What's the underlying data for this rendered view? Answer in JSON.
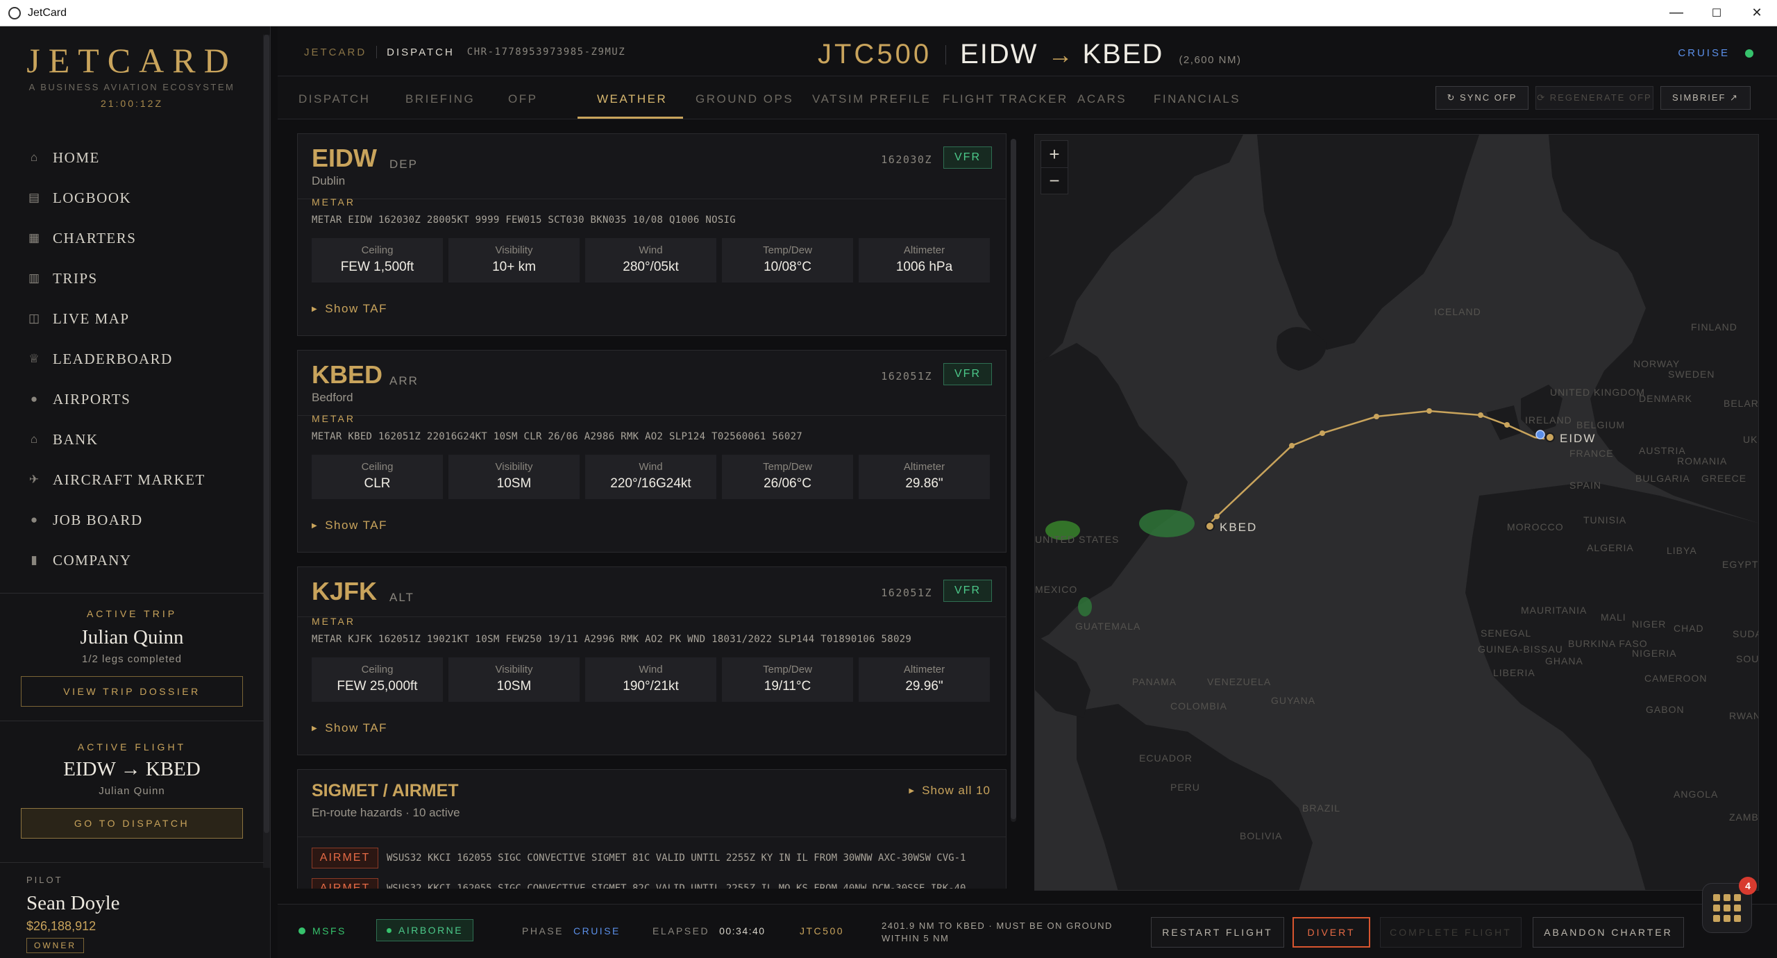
{
  "window": {
    "title": "JetCard",
    "controls": [
      "—",
      "☐",
      "✕"
    ]
  },
  "brand": {
    "name": "JETCARD",
    "tagline": "A BUSINESS AVIATION ECOSYSTEM",
    "clock": "21:00:12Z"
  },
  "nav": [
    {
      "label": "Home",
      "icon": "home-icon"
    },
    {
      "label": "Logbook",
      "icon": "book-icon"
    },
    {
      "label": "Charters",
      "icon": "calendar-icon"
    },
    {
      "label": "Trips",
      "icon": "luggage-icon"
    },
    {
      "label": "Live Map",
      "icon": "map-icon"
    },
    {
      "label": "Leaderboard",
      "icon": "trophy-icon"
    },
    {
      "label": "Airports",
      "icon": "pin-icon"
    },
    {
      "label": "Bank",
      "icon": "bank-icon"
    },
    {
      "label": "Aircraft Market",
      "icon": "plane-icon"
    },
    {
      "label": "Job Board",
      "icon": "person-icon"
    },
    {
      "label": "Company",
      "icon": "building-icon"
    }
  ],
  "active_trip": {
    "eyebrow": "ACTIVE TRIP",
    "name": "Julian Quinn",
    "progress": "1/2 legs completed",
    "button": "VIEW TRIP DOSSIER"
  },
  "active_flight": {
    "eyebrow": "ACTIVE FLIGHT",
    "route": "EIDW → KBED",
    "pax": "Julian Quinn",
    "button": "GO TO DISPATCH"
  },
  "pilot": {
    "eyebrow": "PILOT",
    "name": "Sean Doyle",
    "balance": "$26,188,912",
    "role": "OWNER"
  },
  "header": {
    "crumb_app": "JETCARD",
    "crumb_section": "DISPATCH",
    "charter_id": "CHR-1778953973985-Z9MUZ",
    "callsign": "JTC500",
    "origin": "EIDW",
    "arrow": "→",
    "destination": "KBED",
    "distance": "(2,600 NM)",
    "phase": "CRUISE"
  },
  "tabs": [
    "DISPATCH",
    "BRIEFING",
    "OFP",
    "WEATHER",
    "GROUND OPS",
    "VATSIM PREFILE",
    "FLIGHT TRACKER",
    "ACARS",
    "FINANCIALS"
  ],
  "active_tab": "WEATHER",
  "tools": {
    "sync": "↻ SYNC OFP",
    "regen": "⟳ REGENERATE OFP",
    "simbrief": "SIMBRIEF ↗"
  },
  "metar_label": "METAR",
  "taf_label": "Show TAF",
  "tile_labels": [
    "Ceiling",
    "Visibility",
    "Wind",
    "Temp/Dew",
    "Altimeter"
  ],
  "stations": [
    {
      "code": "EIDW",
      "role": "DEP",
      "city": "Dublin",
      "time": "162030Z",
      "category": "VFR",
      "metar": "METAR EIDW 162030Z 28005KT 9999 FEW015 SCT030 BKN035 10/08 Q1006 NOSIG",
      "values": [
        "FEW 1,500ft",
        "10+ km",
        "280°/05kt",
        "10/08°C",
        "1006 hPa"
      ]
    },
    {
      "code": "KBED",
      "role": "ARR",
      "city": "Bedford",
      "time": "162051Z",
      "category": "VFR",
      "metar": "METAR KBED 162051Z 22016G24KT 10SM CLR 26/06 A2986 RMK AO2 SLP124 T02560061 56027",
      "values": [
        "CLR",
        "10SM",
        "220°/16G24kt",
        "26/06°C",
        "29.86\""
      ]
    },
    {
      "code": "KJFK",
      "role": "ALT",
      "city": "",
      "time": "162051Z",
      "category": "VFR",
      "metar": "METAR KJFK 162051Z 19021KT 10SM FEW250 19/11 A2996 RMK AO2 PK WND 18031/2022 SLP144 T01890106 58029",
      "values": [
        "FEW 25,000ft",
        "10SM",
        "190°/21kt",
        "19/11°C",
        "29.96\""
      ]
    }
  ],
  "sigmet": {
    "title": "SIGMET / AIRMET",
    "subtitle": "En-route hazards · 10 active",
    "show_all": "Show all 10",
    "items": [
      {
        "tag": "AIRMET",
        "text": "WSUS32 KKCI 162055 SIGC CONVECTIVE SIGMET 81C VALID UNTIL 2255Z KY IN IL FROM 30WNW AXC-30WSW CVG-1"
      },
      {
        "tag": "AIRMET",
        "text": "WSUS32 KKCI 162055 SIGC CONVECTIVE SIGMET 82C VALID UNTIL 2255Z IL MO KS FROM 40NW DCM-30SSE IRK-40"
      }
    ]
  },
  "map": {
    "zoom_in": "+",
    "zoom_out": "−",
    "origin_label": "EIDW",
    "dest_label": "KBED",
    "place_labels": [
      "ICELAND",
      "FINLAND",
      "NORWAY",
      "SWEDEN",
      "UNITED KINGDOM",
      "DENMARK",
      "BELARUS",
      "IRELAND",
      "BELGIUM",
      "UKRAINE",
      "FRANCE",
      "AUSTRIA",
      "ROMANIA",
      "BULGARIA",
      "GREECE",
      "SPAIN",
      "TUNISIA",
      "MOROCCO",
      "ALGERIA",
      "LIBYA",
      "EGYPT",
      "UNITED STATES",
      "MEXICO",
      "MAURITANIA",
      "MALI",
      "NIGER",
      "CHAD",
      "SUDAN",
      "SENEGAL",
      "GUINEA-BISSAU",
      "BURKINA FASO",
      "NIGERIA",
      "SOUTH SUDAN",
      "GUATEMALA",
      "PANAMA",
      "VENEZUELA",
      "GUYANA",
      "LIBERIA",
      "GHANA",
      "CAMEROON",
      "COLOMBIA",
      "GABON",
      "RWANDA",
      "ECUADOR",
      "PERU",
      "BRAZIL",
      "ANGOLA",
      "ZAMBIA",
      "BOLIVIA"
    ]
  },
  "footer": {
    "sim": "MSFS",
    "status": "AIRBORNE",
    "phase_label": "PHASE",
    "phase": "CRUISE",
    "elapsed_label": "ELAPSED",
    "elapsed": "00:34:40",
    "callsign": "JTC500",
    "info": "2401.9 NM TO KBED · MUST BE ON GROUND WITHIN 5 NM",
    "restart": "RESTART FLIGHT",
    "divert": "DIVERT",
    "complete": "COMPLETE FLIGHT",
    "abandon": "ABANDON CHARTER"
  },
  "notifications": {
    "count": "4"
  }
}
